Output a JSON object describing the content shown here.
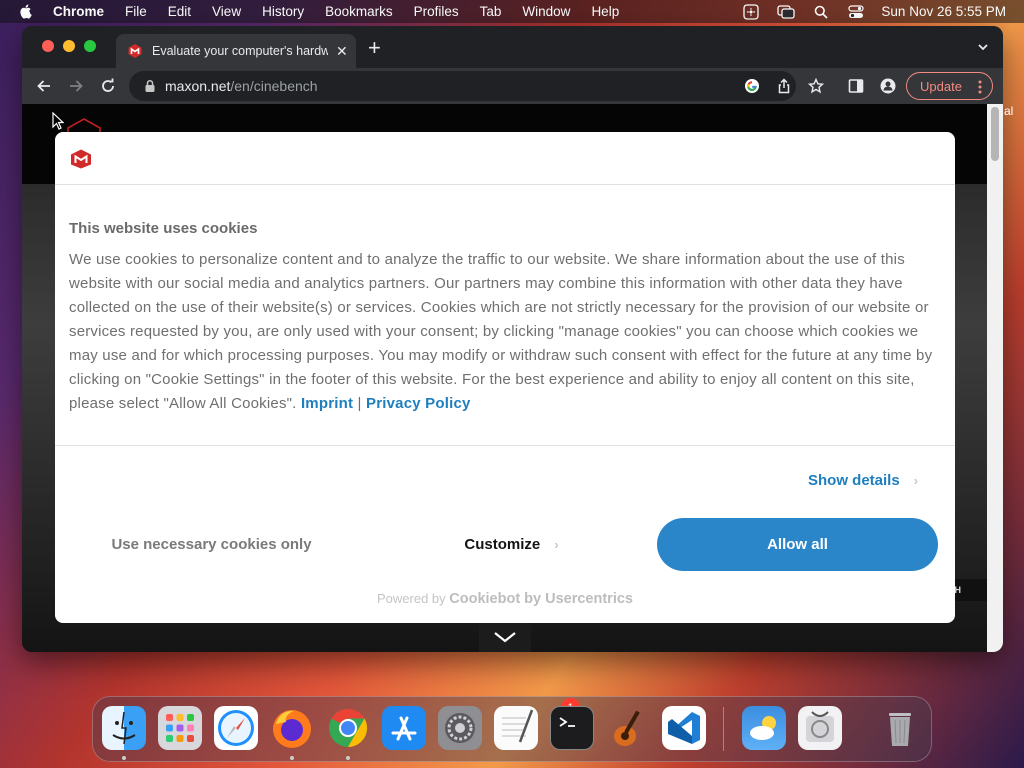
{
  "menubar": {
    "app_name": "Chrome",
    "menus": [
      "File",
      "Edit",
      "View",
      "History",
      "Bookmarks",
      "Profiles",
      "Tab",
      "Window",
      "Help"
    ],
    "clock": "Sun Nov 26  5:55 PM"
  },
  "browser": {
    "tab_title": "Evaluate your computer's hardw",
    "new_tab": "+",
    "url_host": "maxon.net",
    "url_path": "/en/cinebench",
    "update_label": "Update"
  },
  "page": {
    "chip_text": "CH",
    "edge_text": "al"
  },
  "cookie_dialog": {
    "heading": "This website uses cookies",
    "body": "We use cookies to personalize content and to analyze the traffic to our website. We share information about the use of this website with our social media and analytics partners. Our partners may combine this information with other data they have collected on the use of their website(s) or services. Cookies which are not strictly necessary for the provision of our website or services requested by you, are only used with your consent;  by clicking \"manage cookies\" you can choose which cookies we may use and for which processing purposes. You may modify or withdraw such consent with effect for the future at any time by clicking on \"Cookie Settings\" in the footer of this website. For the best experience and ability to enjoy all content on this site, please select \"Allow All Cookies\".",
    "imprint_link": "Imprint",
    "link_separator": "|",
    "privacy_link": "Privacy Policy",
    "show_details": "Show details",
    "btn_necessary": "Use necessary cookies only",
    "btn_customize": "Customize",
    "btn_allow_all": "Allow all",
    "powered_prefix": "Powered by",
    "powered_brand": "Cookiebot by Usercentrics",
    "accent_color": "#2a86c9"
  },
  "dock": {
    "apps": [
      "finder-icon",
      "launchpad-icon",
      "safari-icon",
      "firefox-icon",
      "chrome-icon",
      "app-store-icon",
      "system-settings-icon",
      "textedit-icon",
      "terminal-icon",
      "garageband-icon",
      "vscode-icon",
      "weather-icon",
      "disk-utility-icon",
      "trash-icon"
    ],
    "settings_badge": "1"
  }
}
